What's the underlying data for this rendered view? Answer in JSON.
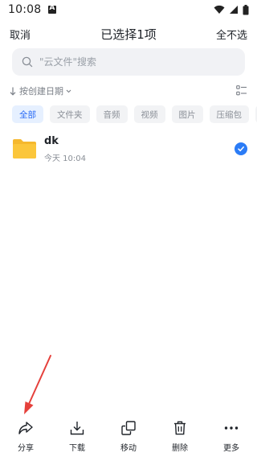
{
  "status_bar": {
    "time": "10:08"
  },
  "header": {
    "left": "取消",
    "title": "已选择1项",
    "right": "全不选"
  },
  "search": {
    "placeholder": "\"云文件\"搜索"
  },
  "sort": {
    "label": "按创建日期"
  },
  "chips": [
    "全部",
    "文件夹",
    "音频",
    "视频",
    "图片",
    "压缩包",
    "其"
  ],
  "file": {
    "name": "dk",
    "date": "今天 10:04"
  },
  "bottom_bar": {
    "share": "分享",
    "download": "下载",
    "move": "移动",
    "delete": "删除",
    "more": "更多"
  },
  "colors": {
    "accent": "#2b7cf6",
    "folder": "#f5b82e",
    "annotation": "#e5403b"
  }
}
